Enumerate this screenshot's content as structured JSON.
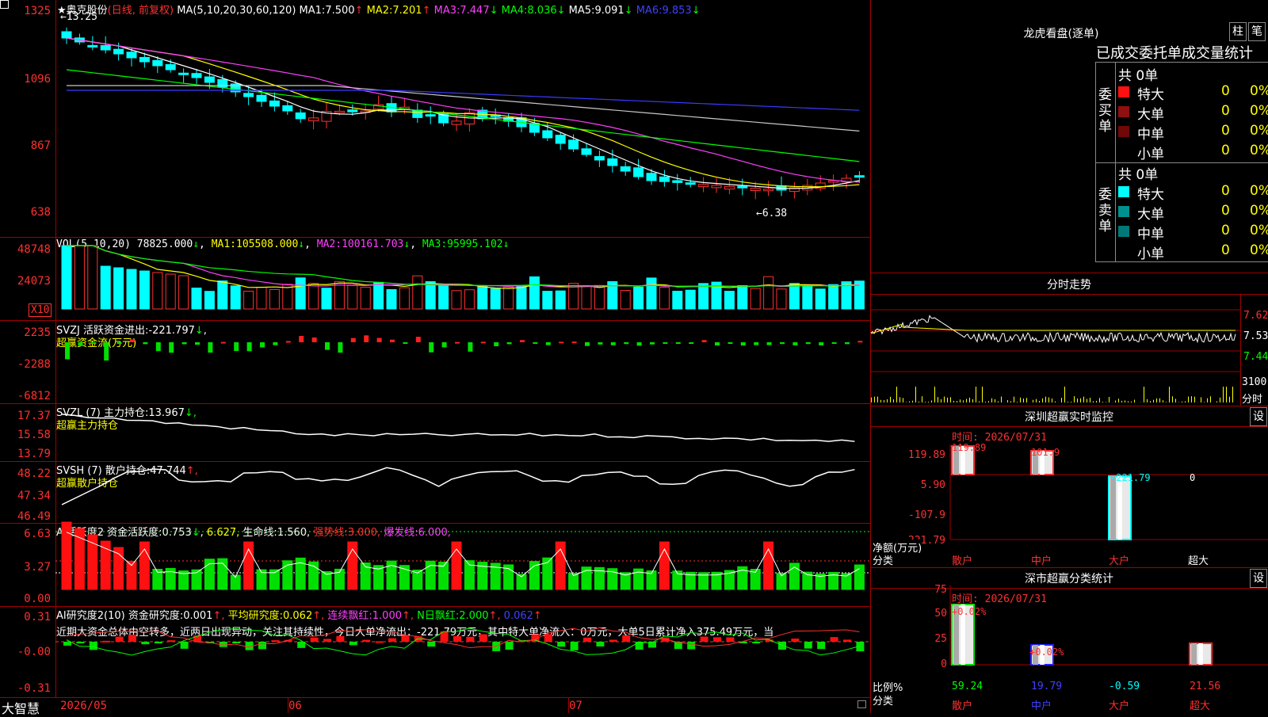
{
  "app": {
    "brand": "大智慧"
  },
  "colors": {
    "up": "#ff3030",
    "down": "#00ffff",
    "grid": "#a00000",
    "ma1": "#ffff00",
    "ma2": "#ff40ff",
    "ma3": "#00ff00",
    "ma4": "#ffffff",
    "ma5": "#3a3aff"
  },
  "kline": {
    "stock": "奥克股份",
    "mode": "(日线, 前复权)",
    "ma_params": "MA(5,10,20,30,60,120)",
    "ma": [
      {
        "label": "MA1:",
        "value": "7.500",
        "arrow": "↑"
      },
      {
        "label": "MA2:",
        "value": "7.201",
        "arrow": "↑"
      },
      {
        "label": "MA3:",
        "value": "7.447",
        "arrow": "↓"
      },
      {
        "label": "MA4:",
        "value": "8.036",
        "arrow": "↓"
      },
      {
        "label": "MA5:",
        "value": "9.091",
        "arrow": "↓"
      },
      {
        "label": "MA6:",
        "value": "9.853",
        "arrow": "↓"
      }
    ],
    "yticks": [
      "1325",
      "1096",
      "867",
      "638"
    ],
    "high_label": "←13.25",
    "low_label": "←6.38"
  },
  "vol": {
    "name": "VOL(5,10,20)",
    "value": "78825.000",
    "arrow": "↓",
    "ma": [
      {
        "label": "MA1:",
        "value": "105508.000",
        "arrow": "↓"
      },
      {
        "label": "MA2:",
        "value": "100161.703",
        "arrow": "↓"
      },
      {
        "label": "MA3:",
        "value": "95995.102",
        "arrow": "↓"
      }
    ],
    "yticks": [
      "48748",
      "24073"
    ],
    "unit": "X10"
  },
  "svzj": {
    "name": "SVZJ",
    "label": "活跃资金进出:",
    "value": "-221.797",
    "arrow": "↓",
    "sub": "超赢资金流(万元)",
    "yticks": [
      "2235",
      "-2288",
      "-6812"
    ]
  },
  "svzl": {
    "name": "SVZL (7)",
    "label": "主力持仓:",
    "value": "13.967",
    "arrow": "↓,",
    "sub": "超赢主力持仓",
    "yticks": [
      "17.37",
      "15.58",
      "13.79"
    ]
  },
  "svsh": {
    "name": "SVSH (7)",
    "label": "散户持仓:",
    "value": "47.744",
    "arrow": "↑,",
    "sub": "超赢散户持仓",
    "yticks": [
      "48.22",
      "47.34",
      "46.49"
    ]
  },
  "ai1": {
    "name": "AI活跃度2",
    "label": "资金活跃度:",
    "value": "0.753",
    "arrow": "↓",
    "v2": "6.627,",
    "label2": "生命线:",
    "v3": "1.560,",
    "label3": "强势线:",
    "v4": "3.000,",
    "label4": "爆发线:",
    "v5": "6.000,",
    "yticks": [
      "6.63",
      "3.27",
      "0.00"
    ]
  },
  "ai2": {
    "name": "AI研究度2(10)",
    "label": "资金研究度:",
    "value": "0.001",
    "arrow": "↑,",
    "label2": "平均研究度:",
    "v2": "0.062",
    "a2": "↑,",
    "label3": "连续飘红:",
    "v3": "1.000",
    "a3": "↑,",
    "label4": "N日飘红:",
    "v4": "2.000",
    "a4": "↑,",
    "v5": "0.062",
    "a5": "↑",
    "note": "近期大资金总体由空转多，近两日出现异动，关注其持续性，今日大单净流出：-221.79万元，其中特大单净流入：0万元，大单5日累计净入375.49万元，当",
    "yticks": [
      "0.31",
      "-0.00",
      "-0.31"
    ]
  },
  "xaxis": {
    "labels": [
      "2026/05",
      "06",
      "07"
    ]
  },
  "longhu": {
    "title": "龙虎看盘(逐单)",
    "btn1": "柱",
    "btn2": "笔",
    "header": "已成交委托单成交量统计",
    "buy": {
      "side": "委买单",
      "total": "共 0单",
      "rows": [
        {
          "label": "特大",
          "count": "0",
          "pct": "0%"
        },
        {
          "label": "大单",
          "count": "0",
          "pct": "0%"
        },
        {
          "label": "中单",
          "count": "0",
          "pct": "0%"
        },
        {
          "label": "小单",
          "count": "0",
          "pct": "0%"
        }
      ]
    },
    "sell": {
      "side": "委卖单",
      "total": "共 0单",
      "rows": [
        {
          "label": "特大",
          "count": "0",
          "pct": "0%"
        },
        {
          "label": "大单",
          "count": "0",
          "pct": "0%"
        },
        {
          "label": "中单",
          "count": "0",
          "pct": "0%"
        },
        {
          "label": "小单",
          "count": "0",
          "pct": "0%"
        }
      ]
    }
  },
  "intraday": {
    "title": "分时走势",
    "yticks": [
      "7.62",
      "7.53",
      "7.44"
    ],
    "vol_label": "3100",
    "vol_unit": "分时"
  },
  "monitor": {
    "title": "深圳超赢实时监控",
    "btn": "设",
    "time_label": "时间: 2026/07/31",
    "yticks": [
      "119.89",
      "5.90",
      "-107.9",
      "-221.79"
    ],
    "ylabel": "净额(万元)",
    "xlabel": "分类",
    "categories": [
      "散户",
      "中户",
      "大户",
      "超大"
    ],
    "values": [
      "119.89",
      "101.9",
      "-221.79",
      "0"
    ]
  },
  "classify": {
    "title": "深市超赢分类统计",
    "btn": "设",
    "time_label": "时间: 2026/07/31",
    "yticks": [
      "75",
      "50",
      "25",
      "0"
    ],
    "ylabel": "比例%",
    "xlabel": "分类",
    "categories": [
      "散户",
      "中户",
      "大户",
      "超大"
    ],
    "top_labels": [
      "+0.02%",
      "+0.02%",
      "",
      ""
    ],
    "values": [
      "59.24",
      "19.79",
      "-0.59",
      "21.56"
    ]
  }
}
